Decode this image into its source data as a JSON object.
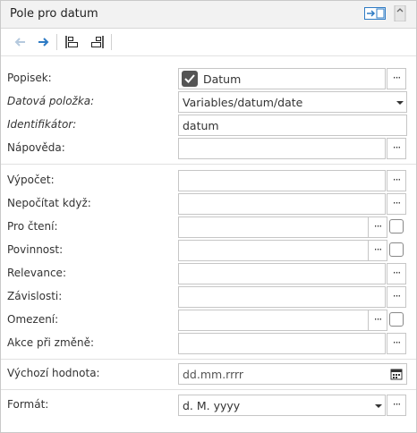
{
  "header": {
    "title": "Pole pro datum",
    "dock_icon": "dock-panel-icon",
    "close_icon": "scroll-indicator-icon"
  },
  "toolbar": {
    "icons": [
      "arrow-left-icon",
      "arrow-right-icon",
      "align-top-left-icon",
      "align-bottom-right-icon"
    ]
  },
  "fields": {
    "popisek": {
      "label": "Popisek:",
      "value": "Datum",
      "checked": true
    },
    "datova_polozka": {
      "label": "Datová položka:",
      "value": "Variables/datum/date"
    },
    "identifikator": {
      "label": "Identifikátor:",
      "value": "datum"
    },
    "napoveda": {
      "label": "Nápověda:",
      "value": ""
    },
    "vypocet": {
      "label": "Výpočet:",
      "value": ""
    },
    "nepocitat_kdyz": {
      "label": "Nepočítat když:",
      "value": ""
    },
    "pro_cteni": {
      "label": "Pro čtení:",
      "value": "",
      "checked": false
    },
    "povinnost": {
      "label": "Povinnost:",
      "value": "",
      "checked": false
    },
    "relevance": {
      "label": "Relevance:",
      "value": ""
    },
    "zavislosti": {
      "label": "Závislosti:",
      "value": ""
    },
    "omezeni": {
      "label": "Omezení:",
      "value": "",
      "checked": false
    },
    "akce_pri_zmene": {
      "label": "Akce při změně:",
      "value": ""
    },
    "vychozi_hodnota": {
      "label": "Výchozí hodnota:",
      "placeholder": "dd.mm.rrrr"
    },
    "format": {
      "label": "Formát:",
      "value": "d. M. yyyy"
    }
  },
  "colors": {
    "accent": "#2e7bc4",
    "header_bg": "#f2f2f2",
    "border": "#c6c6c6"
  }
}
